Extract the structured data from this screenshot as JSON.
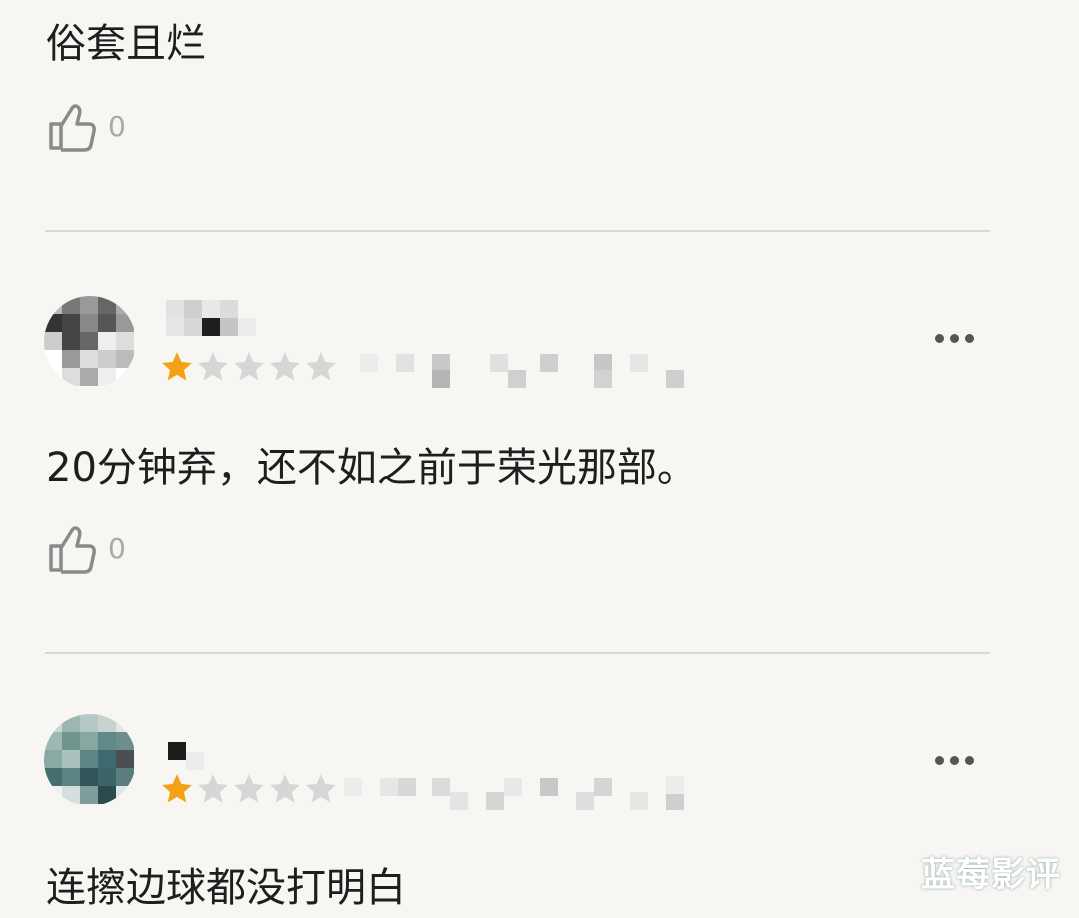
{
  "comments": [
    {
      "text": "俗套且烂",
      "likes": "0"
    },
    {
      "text": "20分钟弃，还不如之前于荣光那部。",
      "likes": "0",
      "rating": 1,
      "max_rating": 5
    },
    {
      "text": "连擦边球都没打明白",
      "rating": 1,
      "max_rating": 5
    }
  ],
  "colors": {
    "star_filled": "#f5a118",
    "star_empty": "#d6d6d6",
    "background": "#f7f6f3"
  },
  "icons": {
    "like": "thumbs-up-icon",
    "more": "more-dots-icon",
    "star": "star-icon"
  },
  "watermark": "蓝莓影评"
}
